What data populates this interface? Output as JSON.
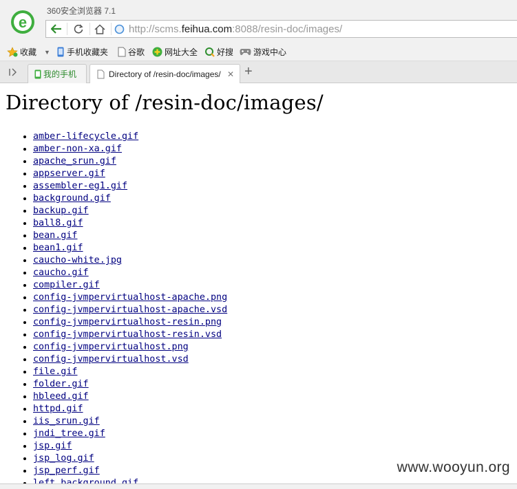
{
  "browser": {
    "app_title": "360安全浏览器 7.1",
    "url_prefix": "http://scms.",
    "url_host": "feihua.com",
    "url_suffix": ":8088/resin-doc/images/"
  },
  "bookmarks": [
    {
      "label": "收藏",
      "icon": "star-icon"
    },
    {
      "label": "手机收藏夹",
      "icon": "phone-icon"
    },
    {
      "label": "谷歌",
      "icon": "page-icon"
    },
    {
      "label": "网址大全",
      "icon": "green-plus-icon"
    },
    {
      "label": "好搜",
      "icon": "search-q-icon"
    },
    {
      "label": "游戏中心",
      "icon": "gamepad-icon"
    }
  ],
  "tabs": {
    "mobile_label": "我的手机",
    "active_title": "Directory of /resin-doc/images/"
  },
  "page": {
    "heading": "Directory of /resin-doc/images/",
    "files": [
      "amber-lifecycle.gif",
      "amber-non-xa.gif",
      "apache_srun.gif",
      "appserver.gif",
      "assembler-eg1.gif",
      "background.gif",
      "backup.gif",
      "ball8.gif",
      "bean.gif",
      "bean1.gif",
      "caucho-white.jpg",
      "caucho.gif",
      "compiler.gif",
      "config-jvmpervirtualhost-apache.png",
      "config-jvmpervirtualhost-apache.vsd",
      "config-jvmpervirtualhost-resin.png",
      "config-jvmpervirtualhost-resin.vsd",
      "config-jvmpervirtualhost.png",
      "config-jvmpervirtualhost.vsd",
      "file.gif",
      "folder.gif",
      "hbleed.gif",
      "httpd.gif",
      "iis_srun.gif",
      "jndi_tree.gif",
      "jsp.gif",
      "jsp_log.gif",
      "jsp_perf.gif",
      "left_background.gif"
    ]
  },
  "watermark": "www.wooyun.org"
}
